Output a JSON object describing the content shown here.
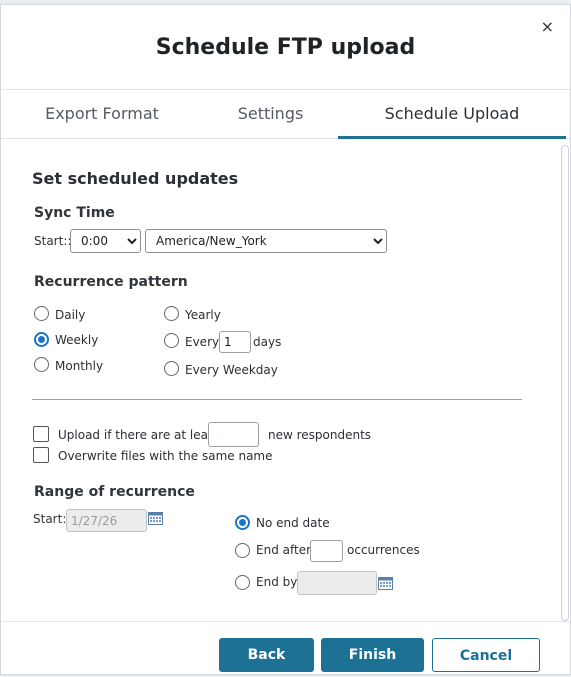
{
  "dialog": {
    "title": "Schedule FTP upload",
    "close_icon": "×"
  },
  "tabs": [
    {
      "label": "Export Format",
      "active": false
    },
    {
      "label": "Settings",
      "active": false
    },
    {
      "label": "Schedule Upload",
      "active": true
    }
  ],
  "section": {
    "heading": "Set scheduled updates",
    "sync_time": {
      "label": "Sync Time",
      "start_label": "Start::",
      "time_value": "0:00",
      "timezone_value": "America/New_York"
    },
    "recurrence": {
      "label": "Recurrence pattern",
      "options": {
        "daily": "Daily",
        "weekly": "Weekly",
        "monthly": "Monthly",
        "yearly": "Yearly",
        "every": "Every",
        "every_days_value": "1",
        "days_suffix": "days",
        "every_weekday": "Every Weekday"
      },
      "selected": "Weekly"
    },
    "upload_if": {
      "prefix": "Upload if there are at least",
      "suffix": "new respondents",
      "value": ""
    },
    "overwrite": {
      "label": "Overwrite files with the same name"
    },
    "range": {
      "label": "Range of recurrence",
      "start_label": "Start:",
      "start_value": "1/27/26",
      "no_end_date": "No end date",
      "end_after": "End after",
      "end_after_value": "",
      "occurrences": "occurrences",
      "end_by": "End by",
      "end_by_value": "",
      "selected": "No end date"
    }
  },
  "footer": {
    "back_label": "Back",
    "finish_label": "Finish",
    "cancel_label": "Cancel"
  },
  "colors": {
    "accent": "#1d7194",
    "radio_selected": "#1a73c4"
  }
}
